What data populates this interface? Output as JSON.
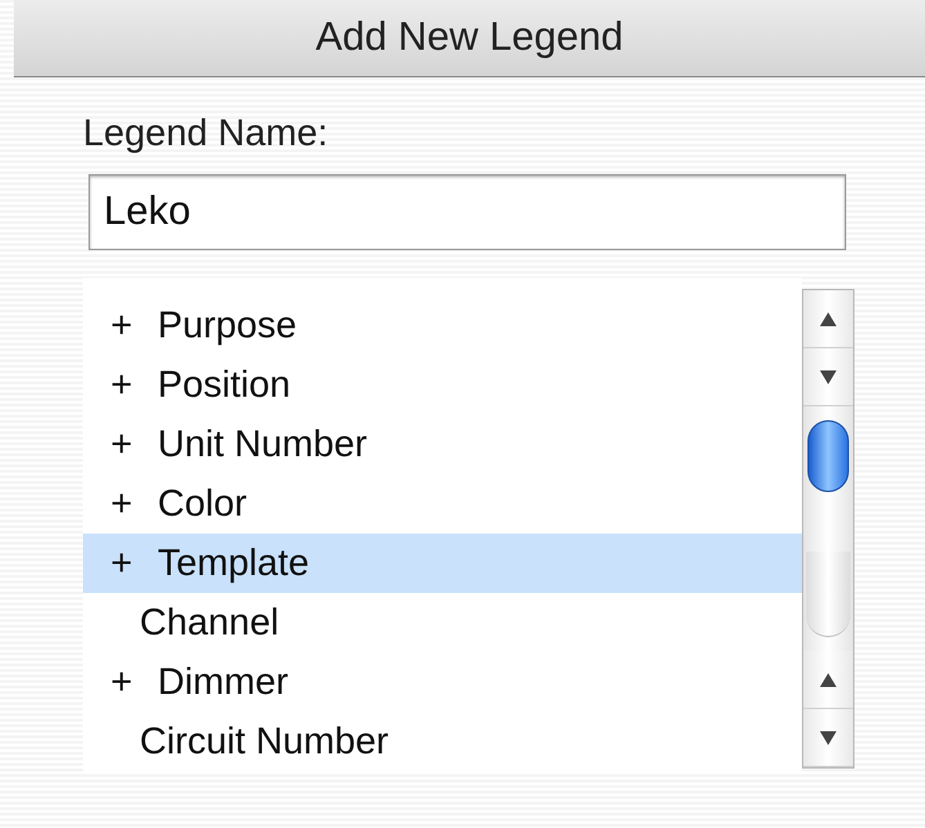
{
  "window": {
    "title": "Add New Legend"
  },
  "legend_name": {
    "label": "Legend Name:",
    "value": "Leko"
  },
  "list": {
    "items": [
      {
        "marker": "+",
        "label": "Purpose",
        "selected": false
      },
      {
        "marker": "+",
        "label": "Position",
        "selected": false
      },
      {
        "marker": "+",
        "label": "Unit Number",
        "selected": false
      },
      {
        "marker": "+",
        "label": "Color",
        "selected": false
      },
      {
        "marker": "+",
        "label": "Template",
        "selected": true
      },
      {
        "label": "Channel",
        "selected": false
      },
      {
        "marker": "+",
        "label": "Dimmer",
        "selected": false
      },
      {
        "label": "Circuit Number",
        "selected": false
      }
    ]
  }
}
